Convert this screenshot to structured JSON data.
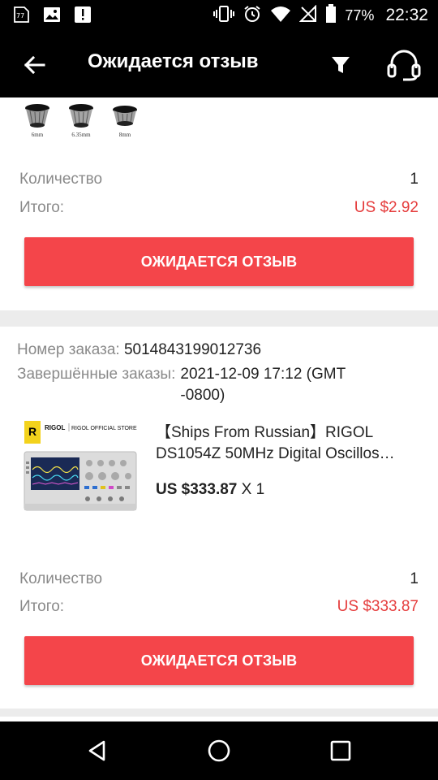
{
  "status_bar": {
    "battery_percent": "77%",
    "time": "22:32",
    "left_icons": [
      "sim-icon",
      "image-icon",
      "alert-icon"
    ],
    "right_icons": [
      "vibrate-icon",
      "alarm-icon",
      "wifi-icon",
      "no-signal-icon",
      "battery-icon"
    ]
  },
  "app_bar": {
    "title": "Ожидается отзыв",
    "icons": [
      "back-arrow-icon",
      "filter-icon",
      "headset-icon"
    ]
  },
  "order1": {
    "thumbnail_labels": [
      "6mm",
      "6.35mm",
      "8mm"
    ],
    "quantity_label": "Количество",
    "quantity_value": "1",
    "total_label": "Итого:",
    "total_value": "US $2.92",
    "button_label": "ОЖИДАЕТСЯ ОТЗЫВ"
  },
  "order2": {
    "order_number_label": "Номер заказа:",
    "order_number": "5014843199012736",
    "completed_label": "Завершённые заказы:",
    "completed_date_line1": "2021-12-09 17:12 (GMT",
    "completed_date_line2": "-0800)",
    "store_logo_text": "RIGOL",
    "store_logo_subtext": "RIGOL OFFICIAL STORE",
    "product_title_line1": "【Ships From Russian】RIGOL",
    "product_title_line2": "DS1054Z 50MHz Digital Oscillos…",
    "product_price": "US $333.87",
    "product_qty": "X 1",
    "quantity_label": "Количество",
    "quantity_value": "1",
    "total_label": "Итого:",
    "total_value": "US $333.87",
    "button_label": "ОЖИДАЕТСЯ ОТЗЫВ"
  },
  "nav_bar": {
    "icons": [
      "back-triangle-icon",
      "home-circle-icon",
      "recents-square-icon"
    ]
  },
  "colors": {
    "accent": "#f4454a",
    "price": "#e53c3c",
    "app_bar": "#000000",
    "background": "#ececec"
  }
}
